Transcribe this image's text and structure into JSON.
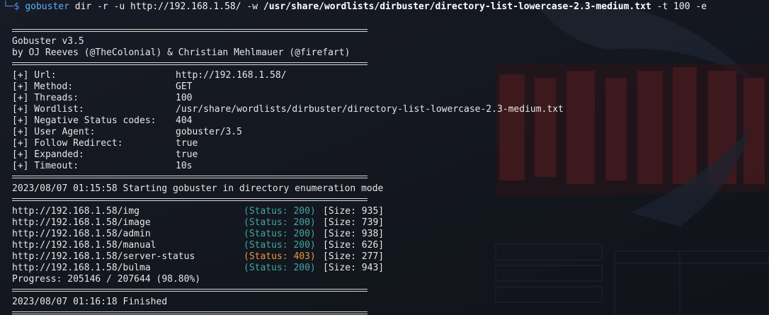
{
  "prompt": {
    "symbol": "└─$",
    "command": "gobuster",
    "args1": "dir -r -u http://192.168.1.58/ -w",
    "wordlist_arg": "/usr/share/wordlists/dirbuster/directory-list-lowercase-2.3-medium.txt",
    "args2": "-t 100 -e"
  },
  "banner": {
    "title": "Gobuster v3.5",
    "author": "by OJ Reeves (@TheColonial) & Christian Mehlmauer (@firefart)"
  },
  "config": [
    {
      "key": "[+] Url:",
      "value": "http://192.168.1.58/"
    },
    {
      "key": "[+] Method:",
      "value": "GET"
    },
    {
      "key": "[+] Threads:",
      "value": "100"
    },
    {
      "key": "[+] Wordlist:",
      "value": "/usr/share/wordlists/dirbuster/directory-list-lowercase-2.3-medium.txt"
    },
    {
      "key": "[+] Negative Status codes:",
      "value": "404"
    },
    {
      "key": "[+] User Agent:",
      "value": "gobuster/3.5"
    },
    {
      "key": "[+] Follow Redirect:",
      "value": "true"
    },
    {
      "key": "[+] Expanded:",
      "value": "true"
    },
    {
      "key": "[+] Timeout:",
      "value": "10s"
    }
  ],
  "start_message": "2023/08/07 01:15:58 Starting gobuster in directory enumeration mode",
  "results": [
    {
      "path": "http://192.168.1.58/img",
      "status": "(Status: 200)",
      "size": "[Size: 935]",
      "code": 200
    },
    {
      "path": "http://192.168.1.58/image",
      "status": "(Status: 200)",
      "size": "[Size: 739]",
      "code": 200
    },
    {
      "path": "http://192.168.1.58/admin",
      "status": "(Status: 200)",
      "size": "[Size: 938]",
      "code": 200
    },
    {
      "path": "http://192.168.1.58/manual",
      "status": "(Status: 200)",
      "size": "[Size: 626]",
      "code": 200
    },
    {
      "path": "http://192.168.1.58/server-status",
      "status": "(Status: 403)",
      "size": "[Size: 277]",
      "code": 403
    },
    {
      "path": "http://192.168.1.58/bulma",
      "status": "(Status: 200)",
      "size": "[Size: 943]",
      "code": 200
    }
  ],
  "progress": "Progress: 205146 / 207644 (98.80%)",
  "finish_message": "2023/08/07 01:16:18 Finished",
  "colors": {
    "background": "#141821",
    "status_200": "#3fa9a0",
    "status_403": "#e39a3b",
    "command": "#5ab0ff"
  }
}
